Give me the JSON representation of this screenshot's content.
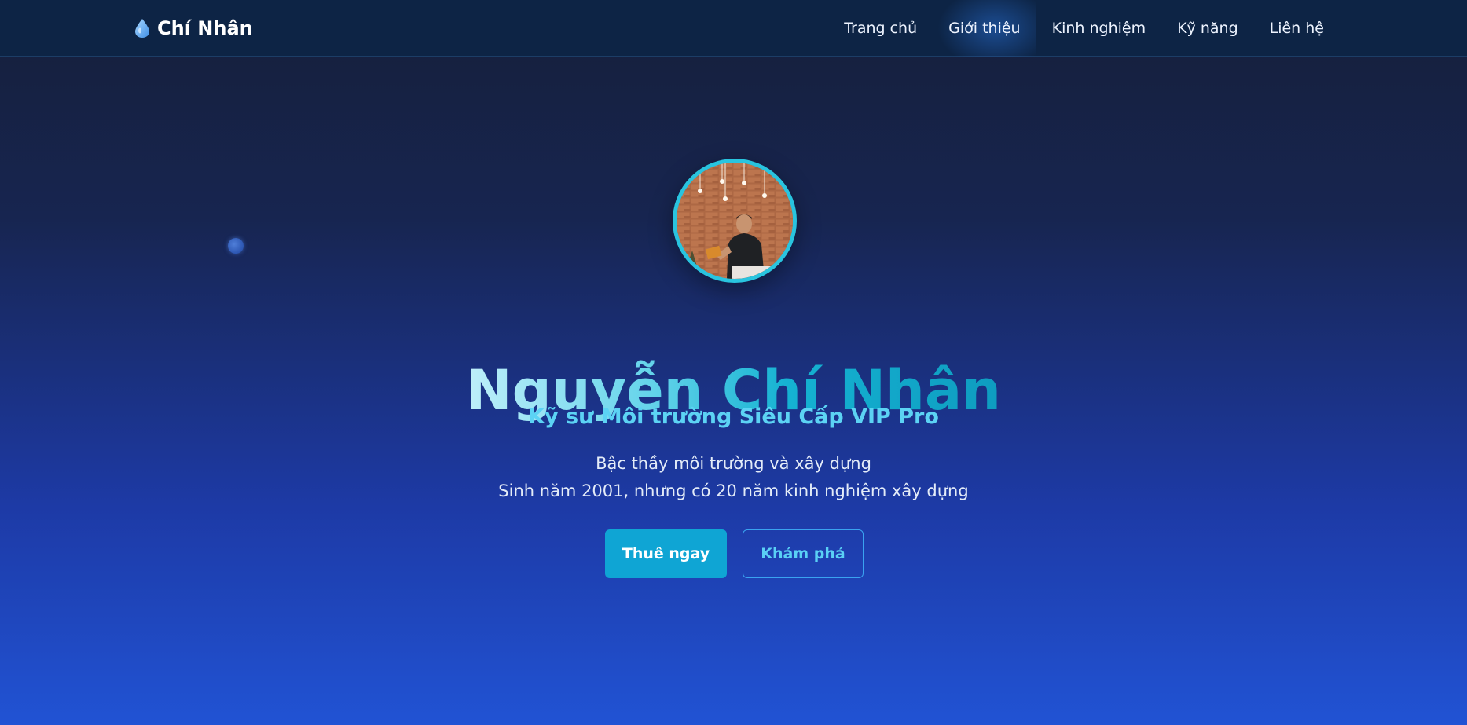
{
  "navbar": {
    "brand": {
      "icon": "water-drop-icon",
      "name": "Chí Nhân"
    },
    "links": [
      {
        "label": "Trang chủ",
        "active": false
      },
      {
        "label": "Giới thiệu",
        "active": true
      },
      {
        "label": "Kinh nghiệm",
        "active": false
      },
      {
        "label": "Kỹ năng",
        "active": false
      },
      {
        "label": "Liên hệ",
        "active": false
      }
    ]
  },
  "hero": {
    "avatar_icon": "profile-photo",
    "name": "Nguyễn Chí Nhân",
    "title": "Kỹ sư Môi trường Siêu Cấp VIP Pro",
    "description_line1": "Bậc thầy môi trường và xây dựng",
    "description_line2": "Sinh năm 2001, nhưng có 20 năm kinh nghiệm xây dựng",
    "primary_button": "Thuê ngay",
    "secondary_button": "Khám phá"
  },
  "colors": {
    "accent": "#0fa5d4",
    "avatar_border": "#29c4df",
    "subtitle": "#5cd3f4",
    "nav_background": "#0d2445"
  }
}
